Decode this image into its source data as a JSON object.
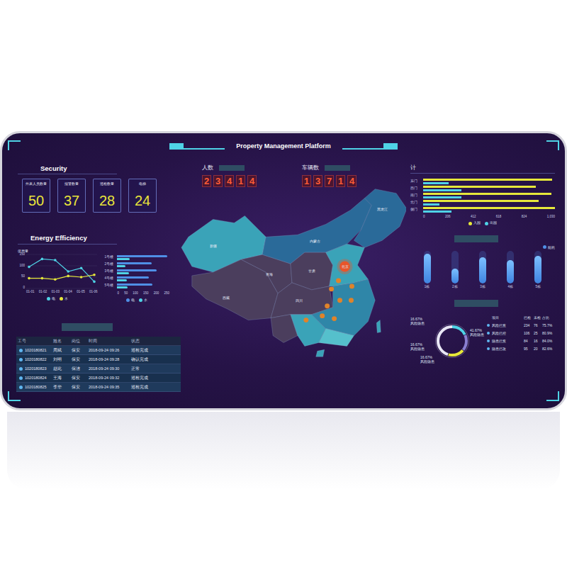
{
  "title": "Property Management Platform",
  "security": {
    "title": "Security",
    "items": [
      {
        "label": "外来人员数量",
        "value": "50"
      },
      {
        "label": "报警数量",
        "value": "37"
      },
      {
        "label": "巡检数量",
        "value": "28"
      },
      {
        "label": "电梯",
        "value": "24"
      }
    ]
  },
  "energy": {
    "title": "Energy Efficiency",
    "line_chart": {
      "y_title": "使用量",
      "y_ticks": [
        "150",
        "100",
        "50",
        "0"
      ],
      "x_ticks": [
        "01-01",
        "01-02",
        "01-03",
        "01-04",
        "01-05",
        "01-06"
      ],
      "series": [
        {
          "name": "电",
          "color": "#4fd3e6",
          "values": [
            95,
            130,
            125,
            75,
            90,
            30
          ]
        },
        {
          "name": "水",
          "color": "#e6e83a",
          "values": [
            45,
            45,
            40,
            55,
            50,
            60
          ]
        }
      ]
    },
    "bar_chart": {
      "categories": [
        "1号楼",
        "2号楼",
        "3号楼",
        "4号楼",
        "5号楼"
      ],
      "x_ticks": [
        "0",
        "50",
        "100",
        "150",
        "200",
        "250"
      ],
      "series": [
        {
          "name": "电",
          "color": "#4f8fe6",
          "values": [
            240,
            165,
            190,
            150,
            170
          ]
        },
        {
          "name": "水",
          "color": "#4fd3e6",
          "values": [
            60,
            40,
            55,
            45,
            50
          ]
        }
      ]
    }
  },
  "table": {
    "columns": [
      "工号",
      "姓名",
      "岗位",
      "时间",
      "状态"
    ],
    "rows": [
      [
        "1020180821",
        "周斌",
        "保安",
        "2018-09-24 09:26",
        "巡检完成"
      ],
      [
        "1020180822",
        "刘明",
        "保安",
        "2018-09-24 09:28",
        "确认完成"
      ],
      [
        "1020180823",
        "赵此",
        "保洁",
        "2018-09-24 09:30",
        "正常"
      ],
      [
        "1020180824",
        "王海",
        "保安",
        "2018-09-24 09:32",
        "巡检完成"
      ],
      [
        "1020180825",
        "李华",
        "保安",
        "2018-09-24 09:35",
        "巡检完成"
      ]
    ]
  },
  "counters": [
    {
      "label": "人数",
      "digits": [
        "2",
        "3",
        "4",
        "1",
        "4"
      ]
    },
    {
      "label": "车辆数",
      "digits": [
        "1",
        "3",
        "7",
        "1",
        "4"
      ]
    }
  ],
  "map": {
    "labels": [
      "新疆",
      "西藏",
      "青海",
      "内蒙古",
      "黑龙江",
      "四川",
      "甘肃",
      "北京"
    ],
    "pins": [
      {
        "highlighted": true
      },
      {
        "highlighted": false
      },
      {
        "highlighted": false
      },
      {
        "highlighted": false
      },
      {
        "highlighted": false
      },
      {
        "highlighted": false
      },
      {
        "highlighted": false
      },
      {
        "highlighted": false
      },
      {
        "highlighted": false
      },
      {
        "highlighted": false
      }
    ]
  },
  "gate_chart": {
    "title": "计",
    "categories": [
      "东门",
      "西门",
      "南门",
      "北门",
      "侧门"
    ],
    "x_ticks": [
      "0",
      "206",
      "412",
      "618",
      "824",
      "1,030"
    ],
    "series": [
      {
        "name": "入园",
        "color": "#e6e83a",
        "values": [
          1010,
          880,
          1000,
          900,
          1030
        ]
      },
      {
        "name": "出园",
        "color": "#4fd3e6",
        "values": [
          200,
          300,
          300,
          130,
          220
        ]
      }
    ]
  },
  "capsule_chart": {
    "legend": {
      "name": "能耗",
      "color": "#4f8fe6"
    },
    "categories": [
      "1栋",
      "2栋",
      "3栋",
      "4栋",
      "5栋"
    ],
    "levels": [
      0.9,
      0.45,
      0.8,
      0.7,
      0.85
    ]
  },
  "ring_chart": {
    "segments": [
      {
        "percent": "16.67%",
        "label": "风险隐患",
        "value": 16.67,
        "color": "#4fd3e6"
      },
      {
        "percent": "16.67%",
        "label": "风险隐患",
        "value": 16.67,
        "color": "#8a7fd0"
      },
      {
        "percent": "16.67%",
        "label": "风险隐患",
        "value": 16.67,
        "color": "#e6e83a"
      },
      {
        "percent": "41.67%",
        "label": "风险隐患",
        "value": 41.67,
        "color": "#e8e6f5"
      }
    ],
    "table": {
      "columns": [
        "项目",
        "已检",
        "未检",
        "占比"
      ],
      "rows": [
        [
          "风险已查",
          "234",
          "76",
          "75.7%"
        ],
        [
          "风险已控",
          "106",
          "25",
          "80.9%"
        ],
        [
          "隐患已查",
          "84",
          "16",
          "84.0%"
        ],
        [
          "隐患已改",
          "95",
          "20",
          "82.6%"
        ]
      ]
    }
  }
}
